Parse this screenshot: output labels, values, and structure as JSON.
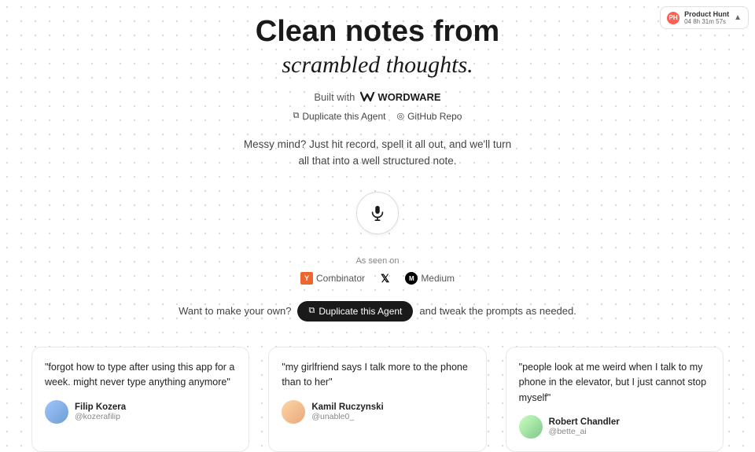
{
  "ph_banner": {
    "logo_label": "PH",
    "title": "Product Hunt",
    "timer": "04 8h 31m 57s",
    "arrow": "▲"
  },
  "hero": {
    "title": "Clean notes from",
    "subtitle": "scrambled thoughts.",
    "built_with_prefix": "Built with",
    "wordware_name": "WORDWARE"
  },
  "links": [
    {
      "icon": "⧉",
      "label": "Duplicate this Agent"
    },
    {
      "icon": "◎",
      "label": "GitHub Repo"
    }
  ],
  "description": {
    "line1": "Messy mind? Just hit record, spell it all out, and we'll turn",
    "line2": "all that into a well structured note."
  },
  "as_seen": {
    "label": "As seen on",
    "logos": [
      {
        "name": "Y Combinator",
        "short": "Y",
        "label": "Combinator"
      },
      {
        "name": "X (Twitter)",
        "label": "𝕏"
      },
      {
        "name": "Medium",
        "short": "M",
        "label": "Medium"
      }
    ]
  },
  "cta": {
    "prefix": "Want to make your own?",
    "button_icon": "⧉",
    "button_label": "Duplicate this Agent",
    "suffix": "and tweak the prompts as needed."
  },
  "testimonials": [
    {
      "quote": "\"forgot how to type after using this app for a week. might never type anything anymore\"",
      "author_name": "Filip Kozera",
      "author_handle": "@kozerafilip",
      "avatar_color": "avatar-filip"
    },
    {
      "quote": "\"my girlfriend says I talk more to the phone than to her\"",
      "author_name": "Kamil Ruczynski",
      "author_handle": "@unable0_",
      "avatar_color": "avatar-kamil"
    },
    {
      "quote": "\"people look at me weird when I talk to my phone in the elevator, but I just cannot stop myself\"",
      "author_name": "Robert Chandler",
      "author_handle": "@bette_ai",
      "avatar_color": "avatar-robert"
    }
  ]
}
